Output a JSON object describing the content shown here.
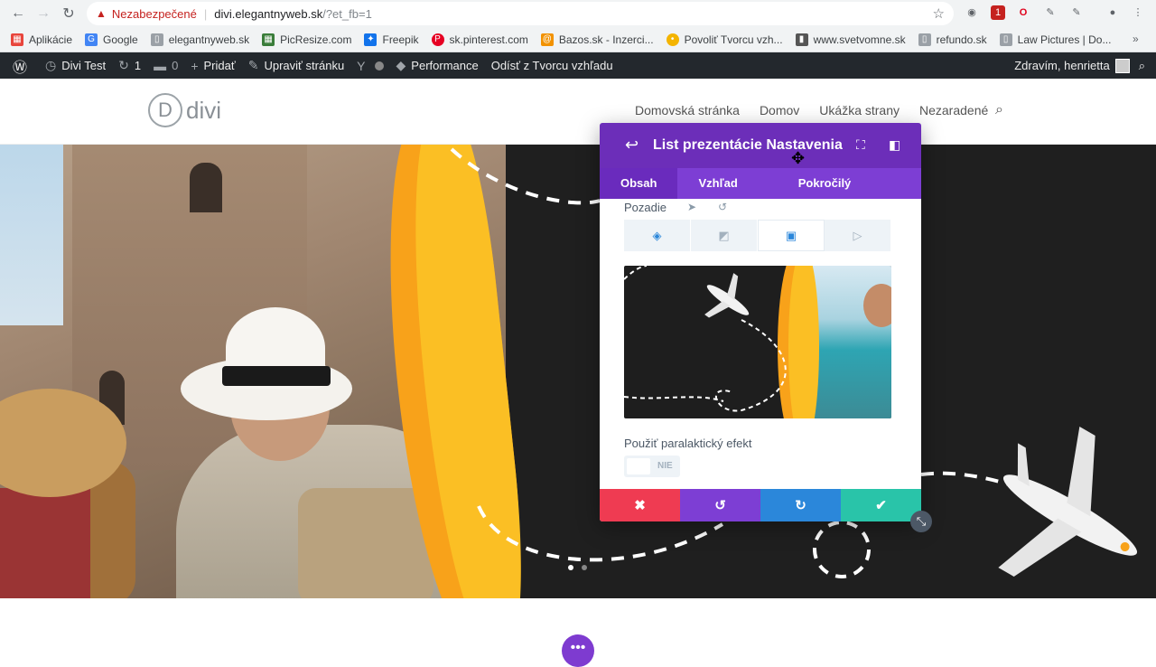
{
  "browser": {
    "insecure_label": "Nezabezpečené",
    "url_domain": "divi.elegantnyweb.sk",
    "url_path": "/?et_fb=1",
    "ext_badge": "1"
  },
  "bookmarks": [
    {
      "label": "Aplikácie",
      "icon": "apps-grid-icon",
      "color": "#e8453c"
    },
    {
      "label": "Google",
      "icon": "google-icon",
      "color": "#4285f4"
    },
    {
      "label": "elegantnyweb.sk",
      "icon": "page-icon",
      "color": "#9aa0a6"
    },
    {
      "label": "PicResize.com",
      "icon": "picresize-icon",
      "color": "#3a7d3a"
    },
    {
      "label": "Freepik",
      "icon": "freepik-icon",
      "color": "#1273eb"
    },
    {
      "label": "sk.pinterest.com",
      "icon": "pinterest-icon",
      "color": "#e60023"
    },
    {
      "label": "Bazos.sk - Inzerci...",
      "icon": "bazos-icon",
      "color": "#f29200"
    },
    {
      "label": "Povoliť Tvorcu vzh...",
      "icon": "divi-icon",
      "color": "#f4b400"
    },
    {
      "label": "www.svetvomne.sk",
      "icon": "svetvomne-icon",
      "color": "#555555"
    },
    {
      "label": "refundo.sk",
      "icon": "page-icon",
      "color": "#9aa0a6"
    },
    {
      "label": "Law Pictures | Do...",
      "icon": "page-icon",
      "color": "#9aa0a6"
    }
  ],
  "wp_admin": {
    "site_name": "Divi Test",
    "updates_count": "1",
    "comments_count": "0",
    "add_new": "Pridať",
    "edit_page": "Upraviť stránku",
    "performance": "Performance",
    "exit_builder": "Odísť z Tvorcu vzhľadu",
    "greeting": "Zdravím, henrietta"
  },
  "site": {
    "logo_letter": "D",
    "logo_text": "divi",
    "nav": [
      "Domovská stránka",
      "Domov",
      "Ukážka strany",
      "Nezaradené"
    ]
  },
  "modal": {
    "title": "List prezentácie Nastavenia",
    "tabs": [
      "Obsah",
      "Vzhľad",
      "Pokročilý"
    ],
    "active_tab": "Obsah",
    "background_label": "Pozadie",
    "background_types": [
      "color-fill-icon",
      "gradient-icon",
      "image-icon",
      "video-icon"
    ],
    "active_background_type": "image-icon",
    "parallax_label": "Použiť paralaktický efekt",
    "parallax_value": "NIE",
    "footer": {
      "cancel": "✖",
      "undo": "↺",
      "redo": "↻",
      "save": "✔"
    }
  },
  "colors": {
    "modal_header": "#6c2eb9",
    "modal_tabs": "#7d3ed4",
    "cancel": "#ef3b52",
    "undo": "#7d3ed4",
    "redo": "#2b87da",
    "save": "#29c4a9",
    "accent_orange": "#f8a21a"
  },
  "slider": {
    "active_dot": 1,
    "total_dots": 2
  }
}
